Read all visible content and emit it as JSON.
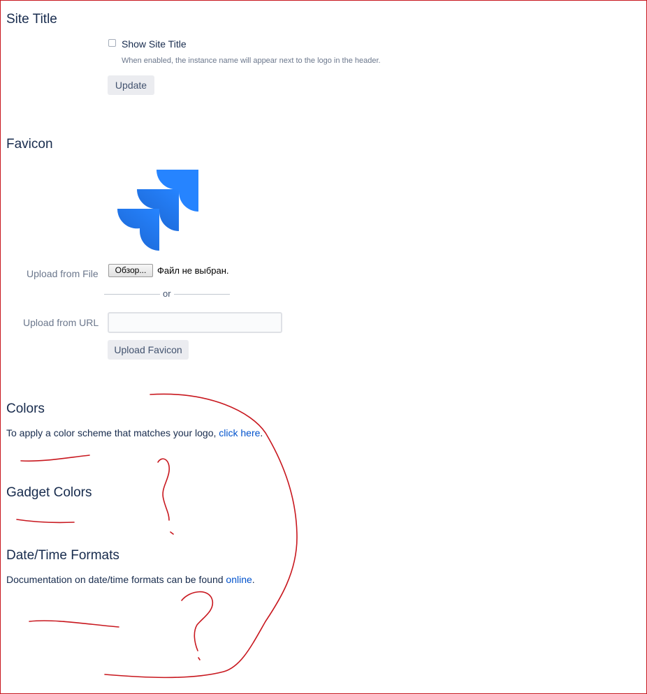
{
  "site_title": {
    "heading": "Site Title",
    "checkbox_label": "Show Site Title",
    "help_text": "When enabled, the instance name will appear next to the logo in the header.",
    "update_label": "Update"
  },
  "favicon": {
    "heading": "Favicon",
    "logo_icon": "jira-logo-icon",
    "upload_file_label": "Upload from File",
    "file_button_label": "Обзор...",
    "file_status": "Файл не выбран.",
    "or_label": "or",
    "upload_url_label": "Upload from URL",
    "url_value": "",
    "upload_button_label": "Upload Favicon"
  },
  "colors": {
    "heading": "Colors",
    "text": "To apply a color scheme that matches your logo, ",
    "link": "click here",
    "suffix": "."
  },
  "gadget_colors": {
    "heading": "Gadget Colors"
  },
  "datetime": {
    "heading": "Date/Time Formats",
    "text": "Documentation on date/time formats can be found ",
    "link": "online",
    "suffix": "."
  },
  "theme": {
    "heading_color": "#172b4d",
    "link_color": "#0052cc",
    "muted_color": "#6b778c",
    "annotation_color": "#c8171e",
    "logo_blue": "#2684ff"
  }
}
